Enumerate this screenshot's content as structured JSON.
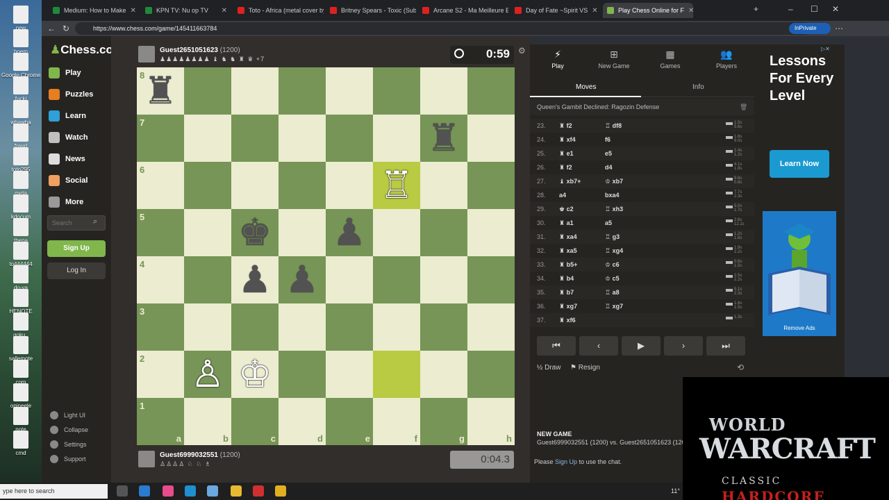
{
  "desktop": {
    "icons": [
      "new",
      "boem",
      "Google Chrome",
      "fucki",
      "whawha",
      "fraud",
      "toto295",
      "meta",
      "kdocum",
      "thena",
      "to444444",
      "do-ya",
      "HENOTE",
      "goku_",
      "sallemote",
      "com",
      "onineele",
      "note",
      "cmd"
    ]
  },
  "browser": {
    "tabs": [
      {
        "label": "Medium: How to Make",
        "color": "#1e8a3a"
      },
      {
        "label": "KPN TV: Nu op TV",
        "color": "#1e8a3a"
      },
      {
        "label": "Toto - Africa (metal cover by",
        "color": "#e02020"
      },
      {
        "label": "Britney Spears - Toxic (Sub.",
        "color": "#e02020"
      },
      {
        "label": "Arcane S2 - Ma Meilleure En",
        "color": "#e02020"
      },
      {
        "label": "Day of Fate ~Spirit VS",
        "color": "#e02020"
      },
      {
        "label": "Play Chess Online for F",
        "color": "#81b64c"
      }
    ],
    "url": "https://www.chess.com/game/145411663784",
    "inprivate": "InPrivate"
  },
  "sidebar": {
    "logo": "Chess.com",
    "nav": [
      {
        "label": "Play",
        "color": "#81b64c"
      },
      {
        "label": "Puzzles",
        "color": "#e67e22"
      },
      {
        "label": "Learn",
        "color": "#2fa0d8"
      },
      {
        "label": "Watch",
        "color": "#c0c0c0"
      },
      {
        "label": "News",
        "color": "#dddddd"
      },
      {
        "label": "Social",
        "color": "#f0a060"
      },
      {
        "label": "More",
        "color": "#999999"
      }
    ],
    "search_placeholder": "Search",
    "signup": "Sign Up",
    "login": "Log In",
    "bottom": [
      "Light UI",
      "Collapse",
      "Settings",
      "Support"
    ]
  },
  "game": {
    "top_player": {
      "name": "Guest2651051623",
      "rating": "(1200)",
      "captured": "♟♟♟♟♟♟♟♟ ♝ ♞ ♞ ♜ ♛ +7"
    },
    "top_clock": "0:59",
    "bottom_player": {
      "name": "Guest6999032551",
      "rating": "(1200)",
      "captured": "♙♙♙♙ ♘ ♘ ♗"
    },
    "bottom_clock": "0:04.3",
    "ranks": [
      "8",
      "7",
      "6",
      "5",
      "4",
      "3",
      "2",
      "1"
    ],
    "files": [
      "a",
      "b",
      "c",
      "d",
      "e",
      "f",
      "g",
      "h"
    ],
    "pieces": [
      {
        "sq": "a8",
        "glyph": "♜",
        "color": "b"
      },
      {
        "sq": "g7",
        "glyph": "♜",
        "color": "b"
      },
      {
        "sq": "f6",
        "glyph": "♖",
        "color": "w"
      },
      {
        "sq": "c5",
        "glyph": "♚",
        "color": "b"
      },
      {
        "sq": "e5",
        "glyph": "♟",
        "color": "b"
      },
      {
        "sq": "c4",
        "glyph": "♟",
        "color": "b"
      },
      {
        "sq": "d4",
        "glyph": "♟",
        "color": "b"
      },
      {
        "sq": "b2",
        "glyph": "♙",
        "color": "w"
      },
      {
        "sq": "c2",
        "glyph": "♔",
        "color": "w"
      }
    ],
    "highlight": [
      "f6",
      "f2"
    ]
  },
  "panel": {
    "tabs": [
      {
        "label": "Play",
        "glyph": "⚡"
      },
      {
        "label": "New Game",
        "glyph": "⊞"
      },
      {
        "label": "Games",
        "glyph": "▦"
      },
      {
        "label": "Players",
        "glyph": "👥"
      }
    ],
    "subtabs": [
      "Moves",
      "Info"
    ],
    "opening": "Queen's Gambit Declined: Ragozin Defense",
    "moves": [
      {
        "n": "23.",
        "w": "♜ f2",
        "b": "♖ df8"
      },
      {
        "n": "24.",
        "w": "♜ xf4",
        "b": "f6"
      },
      {
        "n": "25.",
        "w": "♜ e1",
        "b": "e5"
      },
      {
        "n": "26.",
        "w": "♜ f2",
        "b": "d4"
      },
      {
        "n": "27.",
        "w": "♝ xb7+",
        "b": "♔ xb7"
      },
      {
        "n": "28.",
        "w": "a4",
        "b": "bxa4"
      },
      {
        "n": "29.",
        "w": "♚ c2",
        "b": "♖ xh3"
      },
      {
        "n": "30.",
        "w": "♜ a1",
        "b": "a5"
      },
      {
        "n": "31.",
        "w": "♜ xa4",
        "b": "♖ g3"
      },
      {
        "n": "32.",
        "w": "♜ xa5",
        "b": "♖ xg4"
      },
      {
        "n": "33.",
        "w": "♜ b5+",
        "b": "♔ c6"
      },
      {
        "n": "34.",
        "w": "♜ b4",
        "b": "♔ c5"
      },
      {
        "n": "35.",
        "w": "♜ b7",
        "b": "♖ a8"
      },
      {
        "n": "36.",
        "w": "♜ xg7",
        "b": "♖ xg7"
      },
      {
        "n": "37.",
        "w": "♜ xf6",
        "b": ""
      }
    ],
    "times": [
      [
        "1.5s",
        "5.6s"
      ],
      [
        "1.6s",
        "9.0s"
      ],
      [
        "1.4s",
        "1.2s"
      ],
      [
        "4.1s",
        "1.8s"
      ],
      [
        "9.6s",
        "0.8s"
      ],
      [
        "7.7s",
        "2.3s"
      ],
      [
        "5.0s",
        "1.7s"
      ],
      [
        "2.6s",
        "12.1s"
      ],
      [
        "1.2s",
        "1.8s"
      ],
      [
        "1.9s",
        "2.2s"
      ],
      [
        "0.6s",
        "1.5s"
      ],
      [
        "2.5s",
        "2.2s"
      ],
      [
        "5.1s",
        "2.3s"
      ],
      [
        "1.6s",
        "1.5s"
      ],
      [
        "1.3s",
        ""
      ]
    ],
    "controls": [
      "⏮",
      "‹",
      "▶",
      "›",
      "⏭"
    ],
    "draw": "Draw",
    "resign": "Resign",
    "new_game_title": "NEW GAME",
    "matchup": "Guest6999032551 (1200) vs. Guest2651051623 (1200",
    "chat_prefix": "Please",
    "chat_link": "Sign Up",
    "chat_suffix": "to use the chat."
  },
  "ad": {
    "title": "Lessons For Every Level",
    "button": "Learn Now",
    "remove": "Remove Ads"
  },
  "overlay": {
    "line1": "WORLD",
    "line2": "WARCRAFT",
    "line3": "CLASSIC",
    "line4": "HARDCORE"
  },
  "taskbar": {
    "search": "ype here to search",
    "temp": "11°"
  }
}
